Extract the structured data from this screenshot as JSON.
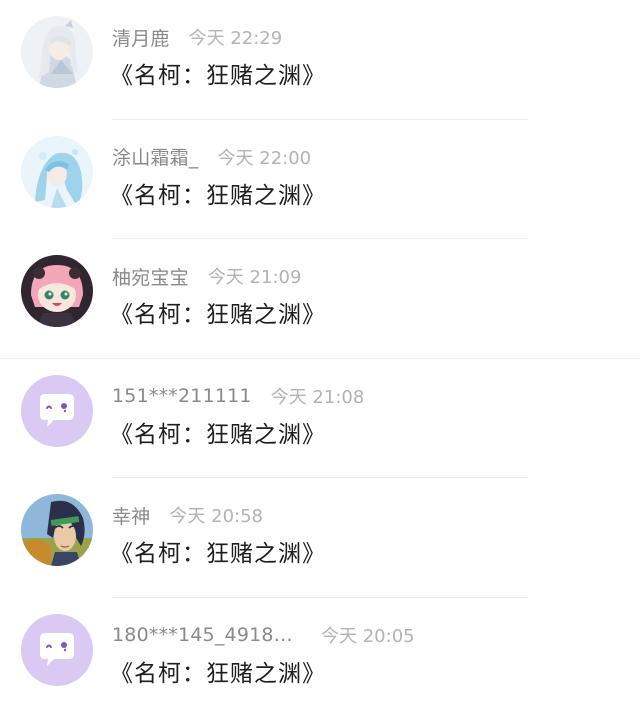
{
  "comments": [
    {
      "name": "清月鹿",
      "time": "今天 22:29",
      "text": "《名柯：狂赌之渊》",
      "avatar": "anime-avatar-white-hair"
    },
    {
      "name": "涂山霜霜_",
      "time": "今天 22:00",
      "text": "《名柯：狂赌之渊》",
      "avatar": "anime-avatar-blue-hair"
    },
    {
      "name": "柚宛宝宝",
      "time": "今天 21:09",
      "text": "《名柯：狂赌之渊》",
      "avatar": "anime-avatar-pink-hair"
    },
    {
      "name": "151***211111",
      "time": "今天 21:08",
      "text": "《名柯：狂赌之渊》",
      "avatar": "default-chat-bubble-icon"
    },
    {
      "name": "幸神",
      "time": "今天 20:58",
      "text": "《名柯：狂赌之渊》",
      "avatar": "anime-avatar-dark-hair-headband"
    },
    {
      "name": "180***145_4918…",
      "time": "今天 20:05",
      "text": "《名柯：狂赌之渊》",
      "avatar": "default-chat-bubble-icon"
    }
  ],
  "colors": {
    "default_avatar_bg": "#d9c9f3",
    "default_avatar_dot": "#7a56c8",
    "name": "#8a8a8a",
    "time": "#b3b3b3",
    "comment_text": "#1e1e1e"
  }
}
